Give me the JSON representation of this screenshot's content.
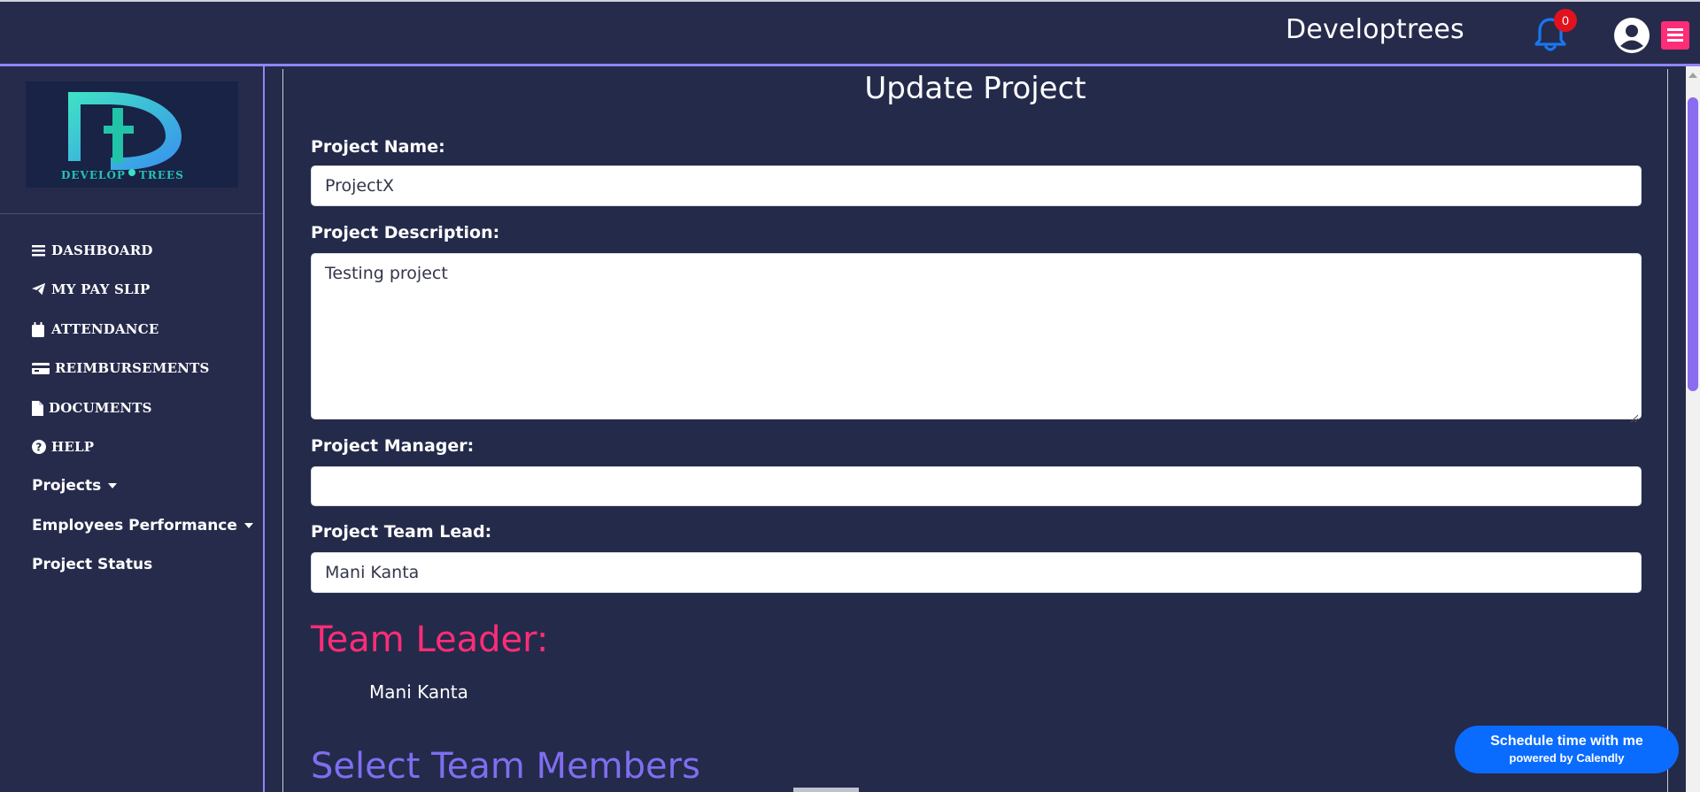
{
  "header": {
    "brand": "Developtrees",
    "notification_count": "0"
  },
  "sidebar": {
    "logo_alt": "DEVELOPTREES",
    "items": [
      {
        "label": "DASHBOARD",
        "icon": "bars-icon"
      },
      {
        "label": "MY PAY SLIP",
        "icon": "paper-plane-icon"
      },
      {
        "label": "ATTENDANCE",
        "icon": "calendar-icon"
      },
      {
        "label": "REIMBURSEMENTS",
        "icon": "credit-card-icon"
      },
      {
        "label": "DOCUMENTS",
        "icon": "file-icon"
      },
      {
        "label": "HELP",
        "icon": "question-circle-icon"
      },
      {
        "label": "Projects",
        "icon": "caret-down-icon"
      },
      {
        "label": "Employees Performance",
        "icon": "caret-down-icon"
      },
      {
        "label": "Project Status",
        "icon": ""
      }
    ]
  },
  "form": {
    "title": "Update Project",
    "name_label": "Project Name:",
    "name_value": "ProjectX",
    "description_label": "Project Description:",
    "description_value": "Testing project",
    "manager_label": "Project Manager:",
    "manager_value": "",
    "team_lead_label": "Project Team Lead:",
    "team_lead_value": "Mani Kanta"
  },
  "team_leader": {
    "heading": "Team Leader:",
    "name": "Mani Kanta"
  },
  "select_members": {
    "heading": "Select Team Members"
  },
  "calendly": {
    "line1": "Schedule time with me",
    "line2": "powered by Calendly"
  },
  "colors": {
    "background": "#242a4a",
    "accent_purple": "#8f86f7",
    "accent_pink": "#ff2d78",
    "calendly_blue": "#0a6bff",
    "badge_red": "#e1121d"
  }
}
